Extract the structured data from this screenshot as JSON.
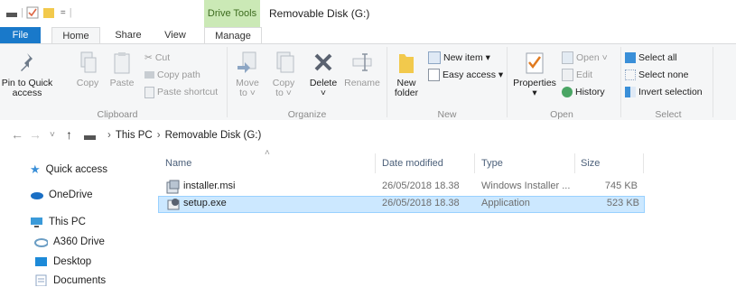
{
  "window": {
    "title": "Removable Disk (G:)",
    "contextual_tab": "Drive Tools"
  },
  "ribbon_tabs": [
    "File",
    "Home",
    "Share",
    "View",
    "Manage"
  ],
  "ribbon": {
    "clipboard": {
      "label": "Clipboard",
      "pin_line1": "Pin to Quick",
      "pin_line2": "access",
      "copy": "Copy",
      "paste": "Paste",
      "cut": "Cut",
      "copy_path": "Copy path",
      "paste_shortcut": "Paste shortcut"
    },
    "organize": {
      "label": "Organize",
      "move_to": "Move",
      "move_to2": "to ˅",
      "copy_to": "Copy",
      "copy_to2": "to ˅",
      "delete": "Delete",
      "delete2": "˅",
      "rename": "Rename"
    },
    "new": {
      "label": "New",
      "new_folder1": "New",
      "new_folder2": "folder",
      "new_item": "New item ▾",
      "easy_access": "Easy access ▾"
    },
    "open": {
      "label": "Open",
      "properties": "Properties",
      "properties2": "▾",
      "open": "Open ˅",
      "edit": "Edit",
      "history": "History"
    },
    "select": {
      "label": "Select",
      "select_all": "Select all",
      "select_none": "Select none",
      "invert": "Invert selection"
    }
  },
  "address": {
    "this_pc": "This PC",
    "separator": "›",
    "current": "Removable Disk (G:)"
  },
  "nav_pane": [
    {
      "label": "Quick access",
      "icon": "star-icon"
    },
    {
      "label": "OneDrive",
      "icon": "cloud-icon"
    },
    {
      "label": "This PC",
      "icon": "computer-icon"
    },
    {
      "label": "A360 Drive",
      "icon": "a360-icon"
    },
    {
      "label": "Desktop",
      "icon": "desktop-icon"
    },
    {
      "label": "Documents",
      "icon": "documents-icon"
    }
  ],
  "columns": {
    "name": "Name",
    "date": "Date modified",
    "type": "Type",
    "size": "Size"
  },
  "files": [
    {
      "name": "installer.msi",
      "date": "26/05/2018 18.38",
      "type": "Windows Installer ...",
      "size": "745 KB"
    },
    {
      "name": "setup.exe",
      "date": "26/05/2018 18.38",
      "type": "Application",
      "size": "523 KB"
    }
  ],
  "colors": {
    "file_tab": "#1979ca",
    "drive_tools": "#cbe9b6",
    "selection": "#cce8ff"
  }
}
